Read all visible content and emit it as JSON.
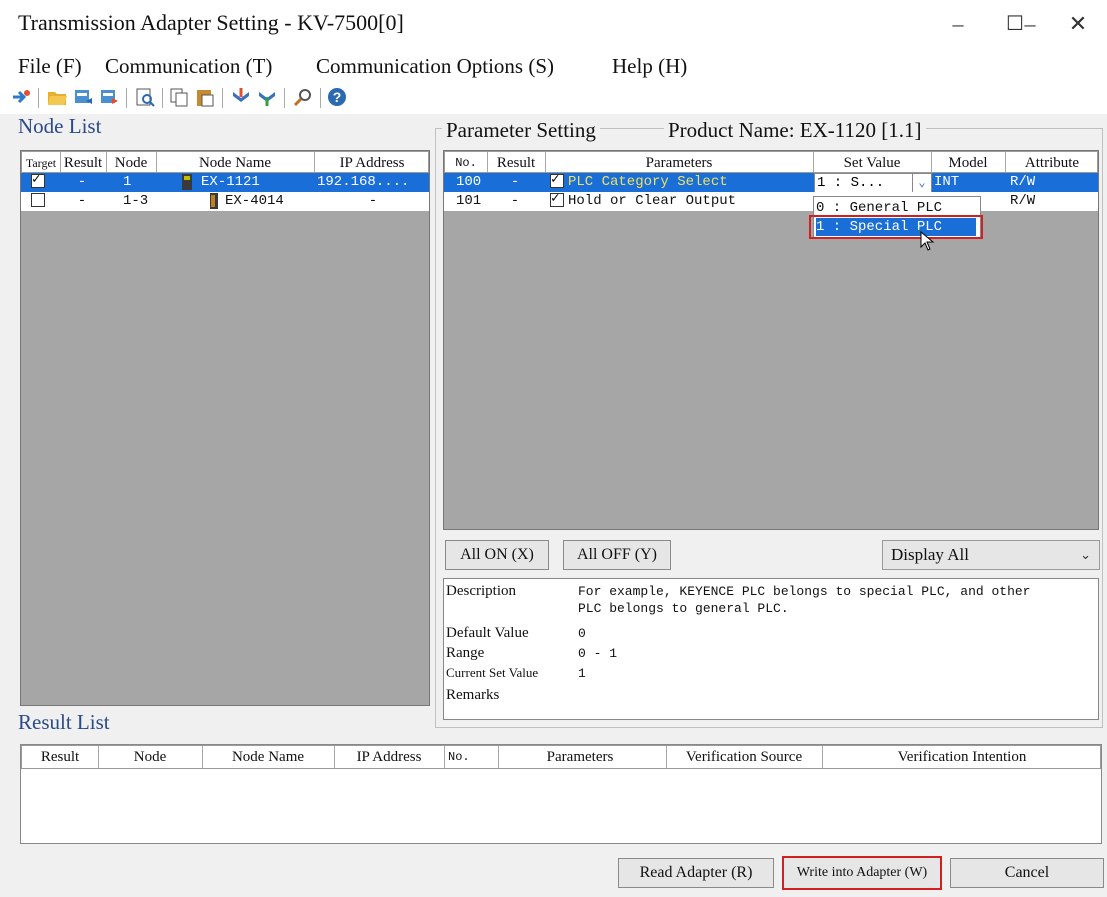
{
  "window": {
    "title": "Transmission Adapter Setting - KV-7500[0]"
  },
  "menu": [
    "File (F)",
    "Communication (T)",
    "Communication Options (S)",
    "Help (H)"
  ],
  "colors": {
    "selection": "#1a6ed8",
    "accent_label": "#2a4a8a",
    "highlight_border": "#d02020"
  },
  "node_list": {
    "label": "Node List",
    "columns": [
      "Target",
      "Result",
      "Node",
      "Node Name",
      "IP Address"
    ],
    "rows": [
      {
        "target": true,
        "result": "-",
        "node": "1",
        "name": "EX-1121",
        "ip": "192.168....",
        "selected": true
      },
      {
        "target": false,
        "result": "-",
        "node": "1-3",
        "name": "EX-4014",
        "ip": "-",
        "selected": false
      }
    ]
  },
  "parameter_setting": {
    "label": "Parameter Setting",
    "product_name": "Product Name: EX-1120 [1.1]",
    "columns": [
      "No.",
      "Result",
      "Parameters",
      "Set Value",
      "Model",
      "Attribute"
    ],
    "rows": [
      {
        "no": "100",
        "result": "-",
        "checked": true,
        "param": "PLC Category Select",
        "value": "1 : S...",
        "model": "INT",
        "attr": "R/W",
        "selected": true
      },
      {
        "no": "101",
        "result": "-",
        "checked": true,
        "param": "Hold or Clear Output",
        "value": "",
        "model": "",
        "attr": "R/W",
        "selected": false
      }
    ],
    "dropdown_options": [
      "0 : General PLC",
      "1 : Special PLC"
    ],
    "all_on": "All ON (X)",
    "all_off": "All OFF (Y)",
    "display_select": "Display All"
  },
  "description": {
    "description_label": "Description",
    "description_line1": "For example, KEYENCE PLC belongs to special PLC, and other",
    "description_line2": "PLC belongs to general PLC.",
    "default_label": "Default Value",
    "default_value": "0",
    "range_label": "Range",
    "range_value": "0 - 1",
    "current_label": "Current Set Value",
    "current_value": "1",
    "remarks_label": "Remarks"
  },
  "result_list": {
    "label": "Result List",
    "columns": [
      "Result",
      "Node",
      "Node Name",
      "IP Address",
      "No.",
      "Parameters",
      "Verification Source",
      "Verification Intention"
    ]
  },
  "footer": {
    "read": "Read Adapter (R)",
    "write": "Write into Adapter (W)",
    "cancel": "Cancel"
  }
}
